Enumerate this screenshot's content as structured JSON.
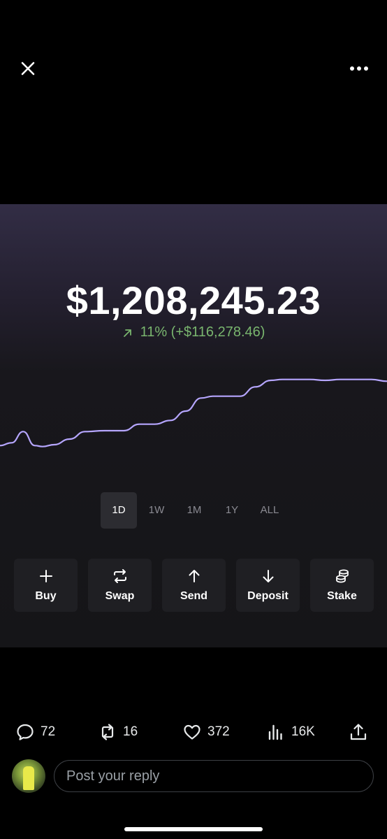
{
  "header": {
    "close_icon": "close-icon",
    "more_icon": "more-horizontal-icon"
  },
  "wallet": {
    "balance": "$1,208,245.23",
    "change_text": "11% (+$116,278.46)",
    "change_color": "#79b56e",
    "change_icon": "arrow-up-right-icon"
  },
  "chart_data": {
    "type": "line",
    "title": "",
    "xlabel": "",
    "ylabel": "",
    "line_color": "#b6a6ff",
    "grid": false,
    "x": [
      0,
      3,
      6,
      9,
      11,
      14,
      18,
      22,
      27,
      32,
      36,
      40,
      44,
      48,
      52,
      55,
      58,
      62,
      66,
      70,
      73,
      76,
      80,
      84,
      88,
      92,
      96,
      100
    ],
    "series": [
      {
        "values": [
          1091000,
          1094000,
          1106000,
          1091000,
          1090000,
          1092000,
          1098000,
          1106000,
          1107000,
          1107000,
          1114000,
          1114000,
          1118000,
          1128000,
          1142000,
          1144000,
          1144000,
          1144000,
          1154000,
          1161000,
          1162000,
          1162000,
          1162000,
          1161000,
          1162000,
          1162000,
          1162000,
          1160000
        ]
      }
    ],
    "ylim": [
      1080000,
      1170000
    ]
  },
  "ranges": {
    "selected": "1D",
    "items": [
      {
        "key": "d1",
        "label": "1D"
      },
      {
        "key": "w1",
        "label": "1W"
      },
      {
        "key": "m1",
        "label": "1M"
      },
      {
        "key": "y1",
        "label": "1Y"
      },
      {
        "key": "all",
        "label": "ALL"
      }
    ]
  },
  "actions": [
    {
      "key": "buy",
      "label": "Buy",
      "icon": "plus-icon"
    },
    {
      "key": "swap",
      "label": "Swap",
      "icon": "swap-icon"
    },
    {
      "key": "send",
      "label": "Send",
      "icon": "arrow-up-icon"
    },
    {
      "key": "deposit",
      "label": "Deposit",
      "icon": "arrow-down-icon"
    },
    {
      "key": "stake",
      "label": "Stake",
      "icon": "coins-icon"
    }
  ],
  "post": {
    "replies": "72",
    "reposts": "16",
    "likes": "372",
    "views": "16K"
  },
  "reply": {
    "placeholder": "Post your reply"
  }
}
